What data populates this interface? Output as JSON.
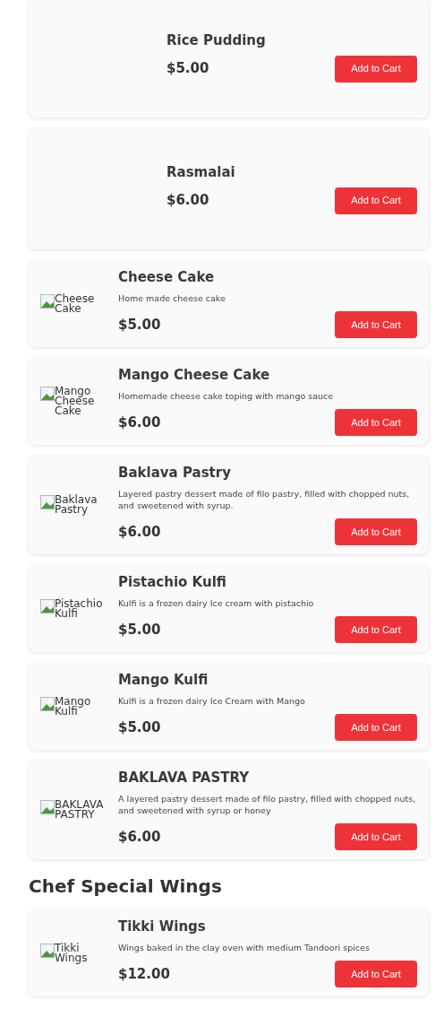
{
  "sections": [
    {
      "items": [
        {
          "name": "Rice Pudding",
          "price": "$5.00",
          "button": "Add to Cart"
        },
        {
          "name": "Rasmalai",
          "price": "$6.00",
          "button": "Add to Cart"
        },
        {
          "name": "Cheese Cake",
          "description": "Home made cheese cake",
          "price": "$5.00",
          "image_alt": "Cheese Cake",
          "button": "Add to Cart"
        },
        {
          "name": "Mango Cheese Cake",
          "description": "Homemade cheese cake toping with mango sauce",
          "price": "$6.00",
          "image_alt": "Mango Cheese Cake",
          "button": "Add to Cart"
        },
        {
          "name": "Baklava Pastry",
          "description": " Layered pastry dessert made of filo pastry, filled with chopped nuts, and sweetened with syrup.",
          "price": "$6.00",
          "image_alt": "Baklava Pastry",
          "button": "Add to Cart"
        },
        {
          "name": "Pistachio Kulfi",
          "description": "Kulfi is a frozen dairy Ice cream with pistachio",
          "price": "$5.00",
          "image_alt": "Pistachio Kulfi",
          "button": "Add to Cart"
        },
        {
          "name": "Mango Kulfi",
          "description": "Kulfi is a frozen dairy Ice Cream with Mango",
          "price": "$5.00",
          "image_alt": "Mango Kulfi",
          "button": "Add to Cart"
        },
        {
          "name": "BAKLAVA PASTRY",
          "description": "A layered pastry dessert made of filo pastry, filled with chopped nuts, and sweetened with syrup or honey",
          "price": "$6.00",
          "image_alt": "BAKLAVA PASTRY",
          "button": "Add to Cart"
        }
      ]
    },
    {
      "heading": "Chef Special Wings",
      "items": [
        {
          "name": "Tikki Wings",
          "description": "Wings baked in the clay oven with medium Tandoori spices",
          "price": "$12.00",
          "image_alt": "Tikki Wings",
          "button": "Add to Cart"
        }
      ]
    }
  ]
}
